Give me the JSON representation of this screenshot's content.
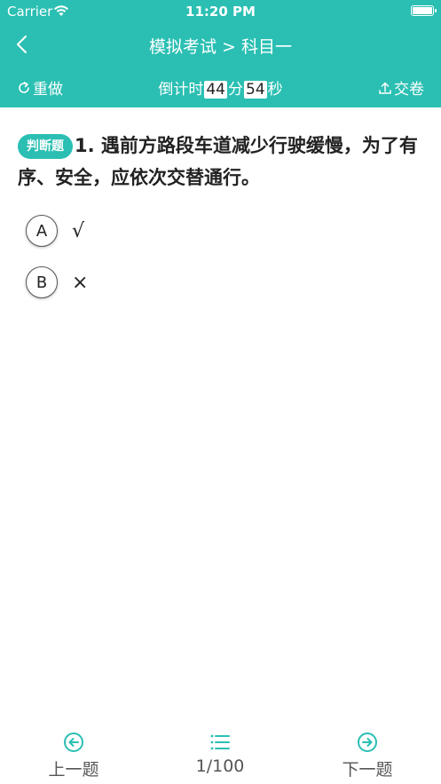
{
  "status_bar": {
    "carrier": "Carrier",
    "time": "11:20 PM"
  },
  "nav": {
    "title": "模拟考试 > 科目一"
  },
  "toolbar": {
    "retry_label": "重做",
    "timer_prefix": "倒计时",
    "minutes": "44",
    "minutes_unit": "分",
    "seconds": "54",
    "seconds_unit": "秒",
    "submit_label": "交卷"
  },
  "question": {
    "type_badge": "判断题",
    "number": "1.",
    "text": "遇前方路段车道减少行驶缓慢，为了有序、安全，应依次交替通行。"
  },
  "options": [
    {
      "letter": "A",
      "text": "√"
    },
    {
      "letter": "B",
      "text": "×"
    }
  ],
  "bottom": {
    "prev_label": "上一题",
    "progress": "1/100",
    "next_label": "下一题"
  },
  "colors": {
    "accent": "#2bbfb3"
  },
  "icons": [
    "wifi-icon",
    "battery-icon",
    "back-arrow-icon",
    "refresh-icon",
    "upload-icon",
    "arrow-left-circle-icon",
    "list-icon",
    "arrow-right-circle-icon"
  ]
}
